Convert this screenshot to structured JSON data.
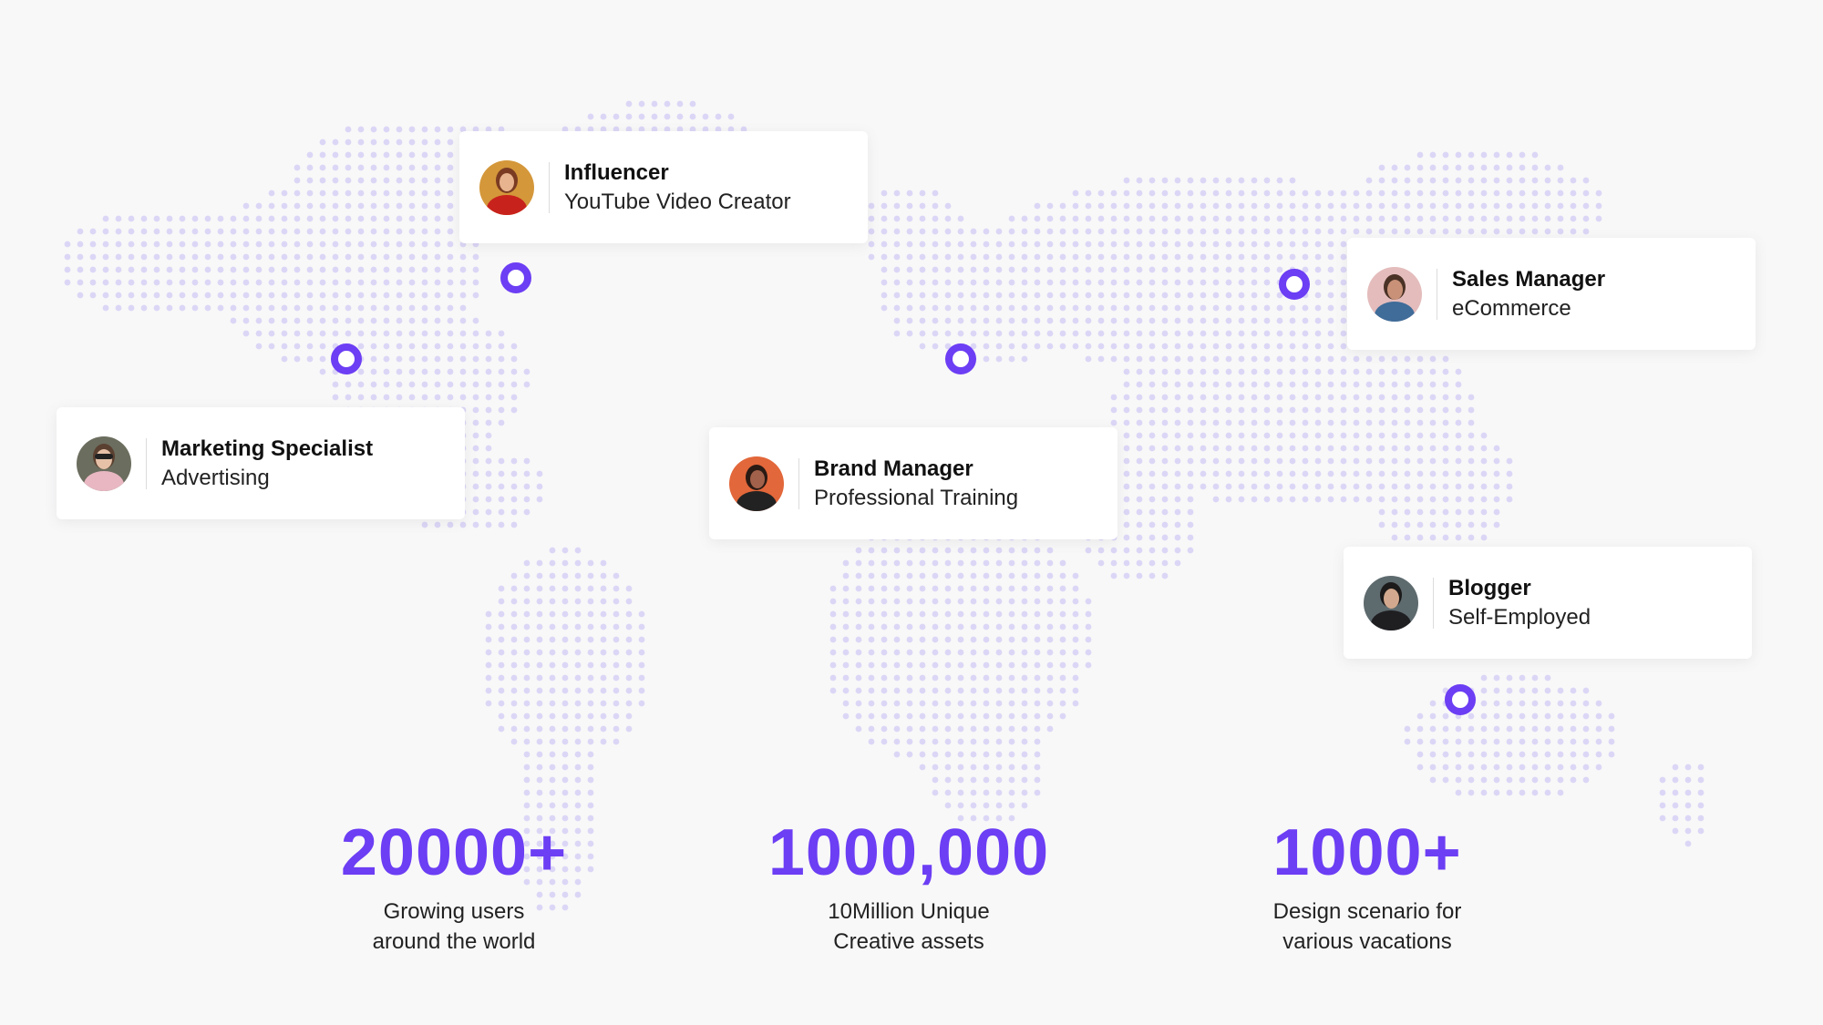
{
  "colors": {
    "accent": "#6c3ef4",
    "map_dot": "#dcd6f6",
    "background": "#f8f8f8",
    "card": "#ffffff"
  },
  "profiles": [
    {
      "id": "influencer",
      "title": "Influencer",
      "subtitle": "YouTube Video Creator",
      "icon": "avatar-woman-red"
    },
    {
      "id": "marketing",
      "title": "Marketing Specialist",
      "subtitle": "Advertising",
      "icon": "avatar-woman-sunglasses"
    },
    {
      "id": "brand",
      "title": "Brand Manager",
      "subtitle": "Professional Training",
      "icon": "avatar-man-orange"
    },
    {
      "id": "sales",
      "title": "Sales Manager",
      "subtitle": "eCommerce",
      "icon": "avatar-man-denim"
    },
    {
      "id": "blogger",
      "title": "Blogger",
      "subtitle": "Self-Employed",
      "icon": "avatar-man-dark"
    }
  ],
  "stats": [
    {
      "value": "20000+",
      "label_line1": "Growing users",
      "label_line2": "around the world"
    },
    {
      "value": "1000,000",
      "label_line1": "10Million Unique",
      "label_line2": "Creative assets"
    },
    {
      "value": "1000+",
      "label_line1": "Design scenario for",
      "label_line2": "various vacations"
    }
  ]
}
